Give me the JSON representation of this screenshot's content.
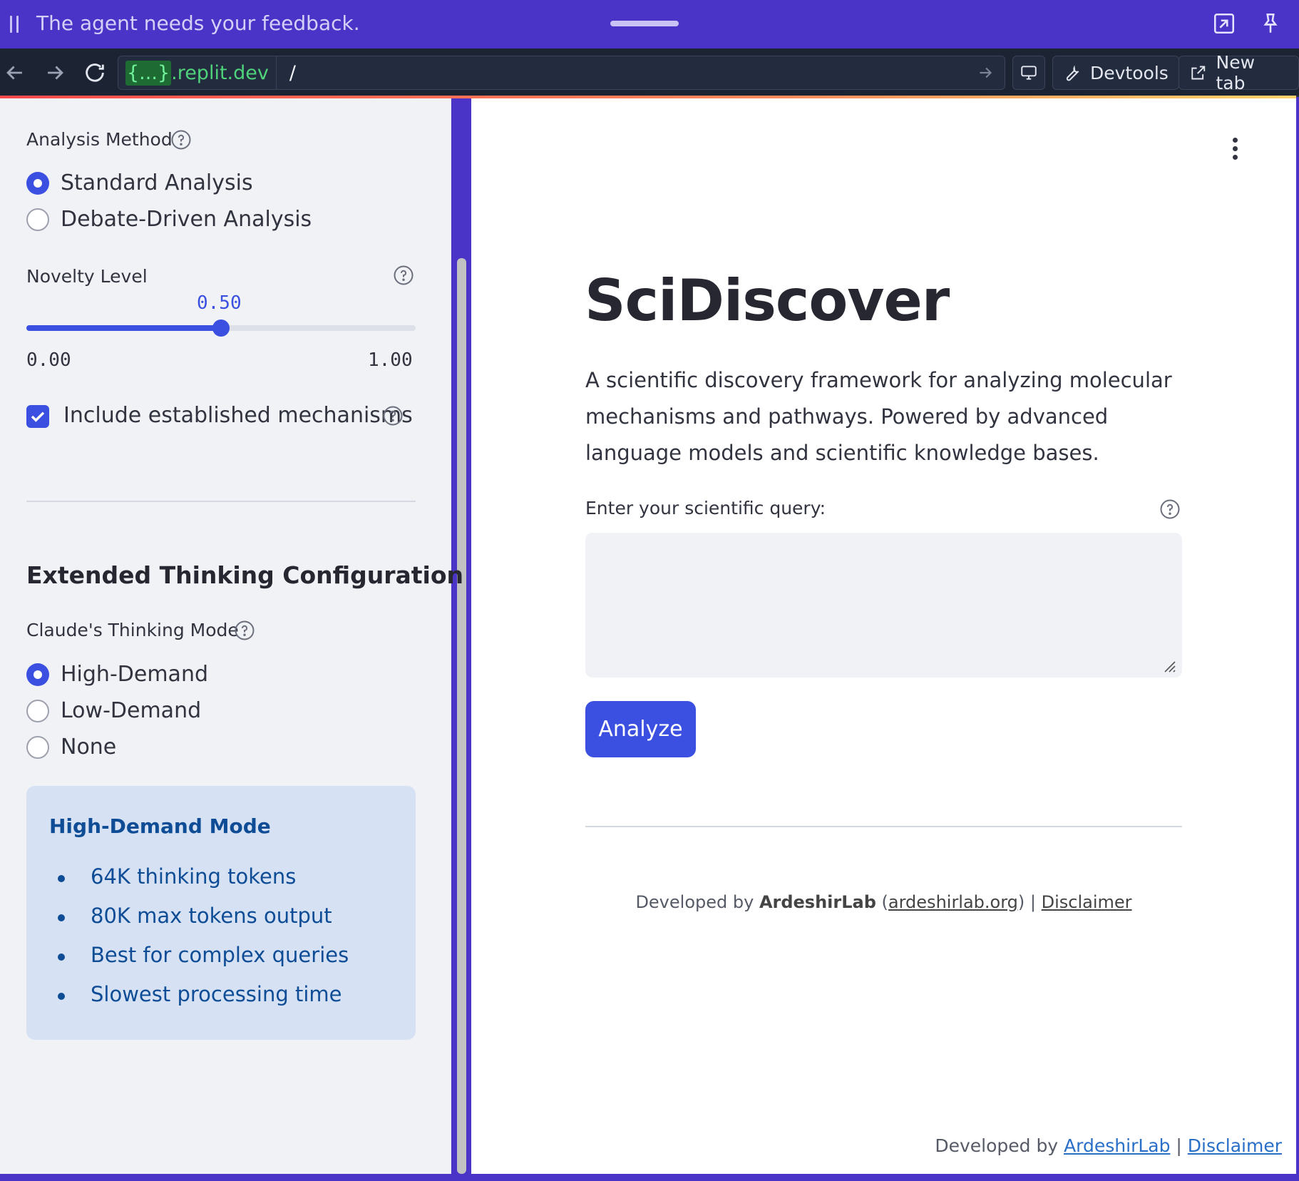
{
  "agent_bar": {
    "message": "The agent needs your feedback."
  },
  "browser": {
    "url_host_brace": "{...}",
    "url_host_domain": ".replit.dev",
    "url_path": "/",
    "devtools_label": "Devtools",
    "new_tab_label": "New tab"
  },
  "sidebar": {
    "analysis_method": {
      "label": "Analysis Method",
      "options": [
        "Standard Analysis",
        "Debate-Driven Analysis"
      ],
      "selected": "Standard Analysis"
    },
    "novelty": {
      "label": "Novelty Level",
      "value": "0.50",
      "min": "0.00",
      "max": "1.00",
      "fraction": 0.5
    },
    "include_established": {
      "label": "Include established mechanisms",
      "checked": true
    },
    "extended_heading": "Extended Thinking Configuration",
    "thinking_mode": {
      "label": "Claude's Thinking Mode",
      "options": [
        "High-Demand",
        "Low-Demand",
        "None"
      ],
      "selected": "High-Demand"
    },
    "info_box": {
      "title": "High-Demand Mode",
      "items": [
        "64K thinking tokens",
        "80K max tokens output",
        "Best for complex queries",
        "Slowest processing time"
      ]
    }
  },
  "main": {
    "title": "SciDiscover",
    "description": "A scientific discovery framework for analyzing molecular mechanisms and pathways. Powered by advanced language models and scientific knowledge bases.",
    "query_label": "Enter your scientific query:",
    "query_value": "",
    "analyze_label": "Analyze",
    "footer": {
      "prefix": "Developed by ",
      "lab": "ArdeshirLab",
      "open_paren": " (",
      "site": "ardeshirlab.org",
      "close_sep": ") | ",
      "disclaimer": "Disclaimer"
    },
    "bottom_footer": {
      "prefix": "Developed by ",
      "lab": "ArdeshirLab",
      "sep": " | ",
      "disclaimer": "Disclaimer"
    }
  },
  "colors": {
    "agent_bar": "#4a34c8",
    "primary": "#3b4fe0",
    "info_text": "#0e4c96",
    "info_bg": "#d6e2f3"
  }
}
